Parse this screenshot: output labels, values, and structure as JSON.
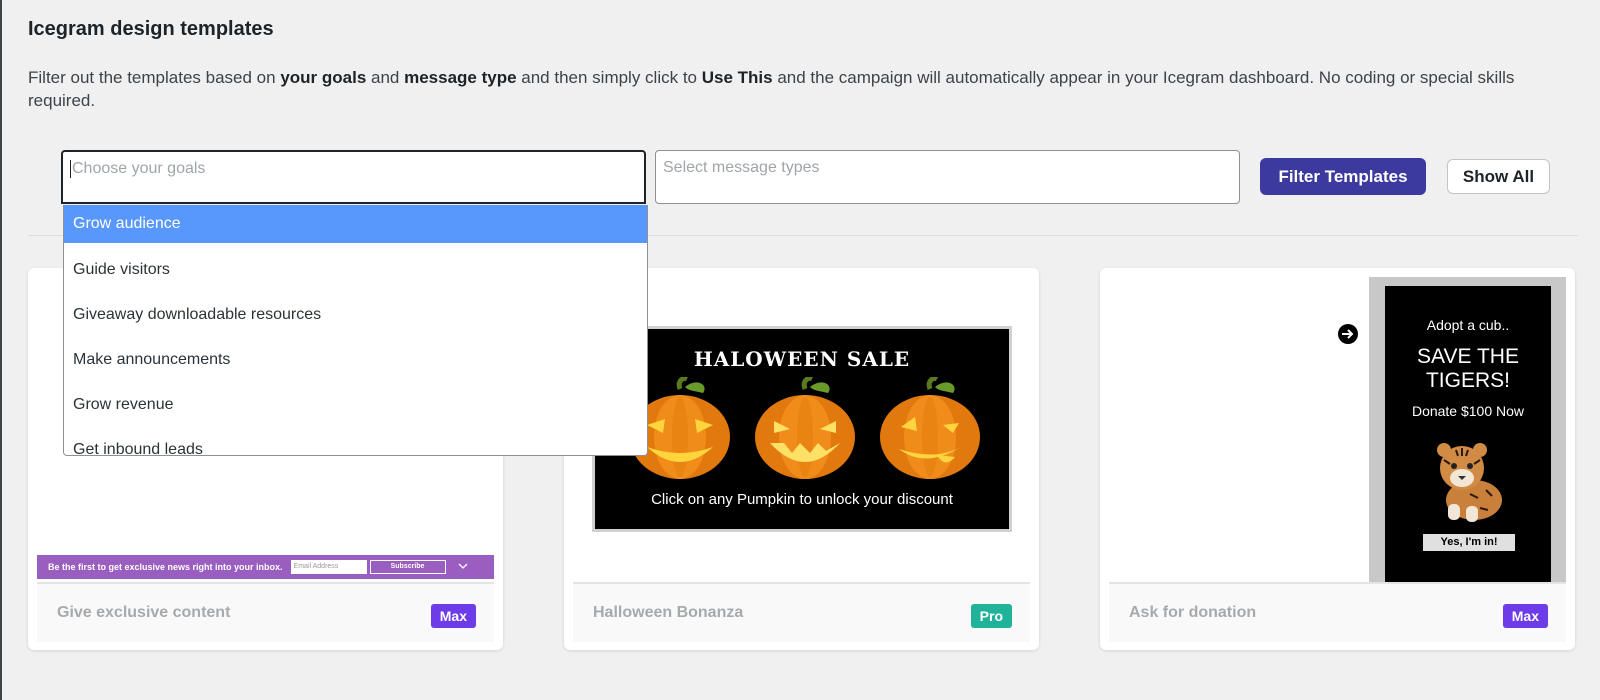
{
  "page": {
    "title": "Icegram design templates",
    "intro_p1": "Filter out the templates based on ",
    "intro_goals": "your goals",
    "intro_p2": " and ",
    "intro_type": "message type",
    "intro_p3": " and then simply click to ",
    "intro_use": "Use This",
    "intro_p4": " and the campaign will automatically appear in your Icegram dashboard. No coding or special skills required."
  },
  "filters": {
    "goals_placeholder": "Choose your goals",
    "types_placeholder": "Select message types",
    "filter_button": "Filter Templates",
    "show_all_button": "Show All"
  },
  "dropdown": {
    "items": [
      {
        "label": "Grow audience",
        "active": true
      },
      {
        "label": "Guide visitors"
      },
      {
        "label": "Giveaway downloadable resources"
      },
      {
        "label": "Make announcements"
      },
      {
        "label": "Grow revenue"
      },
      {
        "label": "Get inbound leads"
      }
    ]
  },
  "cards": [
    {
      "name": "Give exclusive content",
      "badge": "Max",
      "preview": {
        "bar_text": "Be the first to get exclusive news right into your inbox.",
        "email_placeholder": "Email Address",
        "subscribe": "Subscribe",
        "bar_color": "#9a5dc0"
      }
    },
    {
      "name": "Halloween Bonanza",
      "badge": "Pro",
      "preview": {
        "title": "HALOWEEN SALE",
        "caption": "Click on any Pumpkin to unlock your discount"
      }
    },
    {
      "name": "Ask for donation",
      "badge": "Max",
      "preview": {
        "line1": "Adopt a cub..",
        "line2": "SAVE THE TIGERS!",
        "line3": "Donate $100 Now",
        "button": "Yes, I'm in!"
      }
    }
  ],
  "colors": {
    "filter_button": "#3c3a9e",
    "dropdown_active": "#5897fb",
    "badge_max": "#6d3ce8",
    "badge_pro": "#21b29a"
  },
  "icons": {
    "arrow": "arrow-right-circle-icon",
    "chevron": "chevron-down-icon",
    "pumpkin": "pumpkin-icon",
    "tiger": "tiger-cub-icon"
  }
}
